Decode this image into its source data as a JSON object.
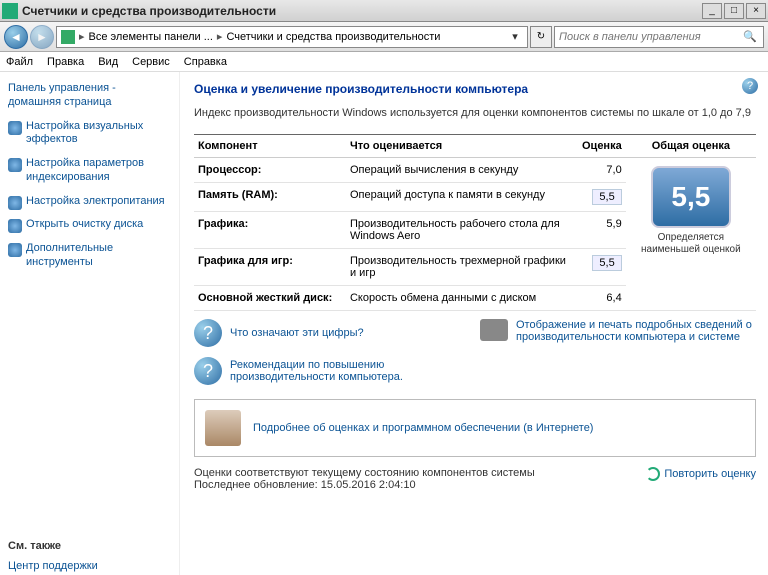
{
  "window": {
    "title": "Счетчики и средства производительности"
  },
  "breadcrumb": {
    "part1": "Все элементы панели ...",
    "part2": "Счетчики и средства производительности"
  },
  "search": {
    "placeholder": "Поиск в панели управления"
  },
  "menus": {
    "file": "Файл",
    "edit": "Правка",
    "view": "Вид",
    "service": "Сервис",
    "help": "Справка"
  },
  "sidebar": {
    "home": "Панель управления - домашняя страница",
    "links": [
      "Настройка визуальных эффектов",
      "Настройка параметров индексирования",
      "Настройка электропитания",
      "Открыть очистку диска",
      "Дополнительные инструменты"
    ],
    "see_also_hdr": "См. также",
    "see_also": "Центр поддержки"
  },
  "heading": "Оценка и увеличение производительности компьютера",
  "subtext": "Индекс производительности Windows используется для оценки компонентов системы по шкале от 1,0 до 7,9",
  "table": {
    "h_component": "Компонент",
    "h_what": "Что оценивается",
    "h_score": "Оценка",
    "h_overall": "Общая оценка",
    "rows": [
      {
        "c": "Процессор:",
        "d": "Операций вычисления в секунду",
        "s": "7,0",
        "hl": false
      },
      {
        "c": "Память (RAM):",
        "d": "Операций доступа к памяти в секунду",
        "s": "5,5",
        "hl": true
      },
      {
        "c": "Графика:",
        "d": "Производительность рабочего стола для Windows Aero",
        "s": "5,9",
        "hl": false
      },
      {
        "c": "Графика для игр:",
        "d": "Производительность трехмерной графики и игр",
        "s": "5,5",
        "hl": true
      },
      {
        "c": "Основной жесткий диск:",
        "d": "Скорость обмена данными с диском",
        "s": "6,4",
        "hl": false
      }
    ],
    "overall_score": "5,5",
    "overall_caption": "Определяется наименьшей оценкой"
  },
  "help_links": {
    "what": "Что означают эти цифры?",
    "tips": "Рекомендации по повышению производительности компьютера.",
    "print": "Отображение и печать подробных сведений о производительности компьютера и системе",
    "more": "Подробнее об оценках и программном обеспечении (в Интернете)"
  },
  "status": {
    "line1": "Оценки соответствуют текущему состоянию компонентов системы",
    "line2": "Последнее обновление: 15.05.2016 2:04:10",
    "rerun": "Повторить оценку"
  }
}
